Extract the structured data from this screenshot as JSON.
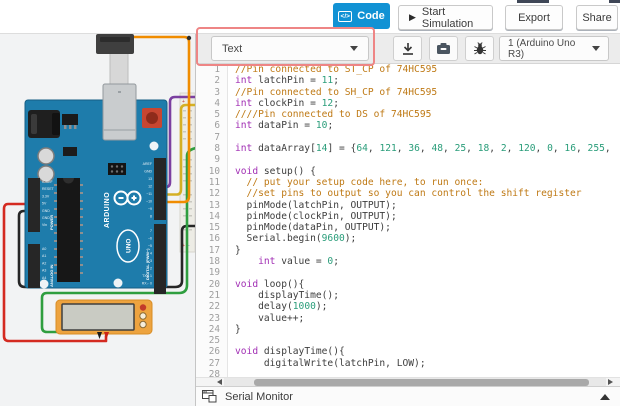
{
  "top_bar": {
    "code_label": "Code",
    "code_icon": "</>",
    "start_simulation_label": "Start Simulation",
    "export_label": "Export",
    "share_label": "Share"
  },
  "code_panel": {
    "toolbar": {
      "edit_mode_value": "Text",
      "board_selector_value": "1 (Arduino Uno R3)",
      "icons": [
        "download-icon",
        "library-icon",
        "debug-icon"
      ]
    },
    "editor": {
      "start_line": 1,
      "lines": [
        [
          {
            "t": "c",
            "s": "//Pin connected to ST_CP of 74HC595"
          }
        ],
        [
          {
            "t": "k",
            "s": "int"
          },
          {
            "t": "p",
            "s": " latchPin = "
          },
          {
            "t": "n",
            "s": "11"
          },
          {
            "t": "p",
            "s": ";"
          }
        ],
        [
          {
            "t": "c",
            "s": "//Pin connected to SH_CP of 74HC595"
          }
        ],
        [
          {
            "t": "k",
            "s": "int"
          },
          {
            "t": "p",
            "s": " clockPin = "
          },
          {
            "t": "n",
            "s": "12"
          },
          {
            "t": "p",
            "s": ";"
          }
        ],
        [
          {
            "t": "c",
            "s": "////Pin connected to DS of 74HC595"
          }
        ],
        [
          {
            "t": "k",
            "s": "int"
          },
          {
            "t": "p",
            "s": " dataPin = "
          },
          {
            "t": "n",
            "s": "10"
          },
          {
            "t": "p",
            "s": ";"
          }
        ],
        [],
        [
          {
            "t": "k",
            "s": "int"
          },
          {
            "t": "p",
            "s": " dataArray["
          },
          {
            "t": "n",
            "s": "14"
          },
          {
            "t": "p",
            "s": "] = {"
          },
          {
            "t": "n",
            "s": "64"
          },
          {
            "t": "p",
            "s": ", "
          },
          {
            "t": "n",
            "s": "121"
          },
          {
            "t": "p",
            "s": ", "
          },
          {
            "t": "n",
            "s": "36"
          },
          {
            "t": "p",
            "s": ", "
          },
          {
            "t": "n",
            "s": "48"
          },
          {
            "t": "p",
            "s": ", "
          },
          {
            "t": "n",
            "s": "25"
          },
          {
            "t": "p",
            "s": ", "
          },
          {
            "t": "n",
            "s": "18"
          },
          {
            "t": "p",
            "s": ", "
          },
          {
            "t": "n",
            "s": "2"
          },
          {
            "t": "p",
            "s": ", "
          },
          {
            "t": "n",
            "s": "120"
          },
          {
            "t": "p",
            "s": ", "
          },
          {
            "t": "n",
            "s": "0"
          },
          {
            "t": "p",
            "s": ", "
          },
          {
            "t": "n",
            "s": "16"
          },
          {
            "t": "p",
            "s": ", "
          },
          {
            "t": "n",
            "s": "255"
          },
          {
            "t": "p",
            "s": ","
          }
        ],
        [],
        [
          {
            "t": "k",
            "s": "void"
          },
          {
            "t": "p",
            "s": " setup() {"
          }
        ],
        [
          {
            "t": "c",
            "s": "  // put your setup code here, to run once:"
          }
        ],
        [
          {
            "t": "c",
            "s": "  //set pins to output so you can control the shift register"
          }
        ],
        [
          {
            "t": "p",
            "s": "  pinMode(latchPin, OUTPUT);"
          }
        ],
        [
          {
            "t": "p",
            "s": "  pinMode(clockPin, OUTPUT);"
          }
        ],
        [
          {
            "t": "p",
            "s": "  pinMode(dataPin, OUTPUT);"
          }
        ],
        [
          {
            "t": "p",
            "s": "  Serial.begin("
          },
          {
            "t": "n",
            "s": "9600"
          },
          {
            "t": "p",
            "s": ");"
          }
        ],
        [
          {
            "t": "p",
            "s": "}"
          }
        ],
        [
          {
            "t": "p",
            "s": "    "
          },
          {
            "t": "k",
            "s": "int"
          },
          {
            "t": "p",
            "s": " value = "
          },
          {
            "t": "n",
            "s": "0"
          },
          {
            "t": "p",
            "s": ";"
          }
        ],
        [],
        [
          {
            "t": "k",
            "s": "void"
          },
          {
            "t": "p",
            "s": " loop(){"
          }
        ],
        [
          {
            "t": "p",
            "s": "    displayTime();"
          }
        ],
        [
          {
            "t": "p",
            "s": "    delay("
          },
          {
            "t": "n",
            "s": "1000"
          },
          {
            "t": "p",
            "s": ");"
          }
        ],
        [
          {
            "t": "p",
            "s": "    value++;"
          }
        ],
        [
          {
            "t": "p",
            "s": "}"
          }
        ],
        [],
        [
          {
            "t": "k",
            "s": "void"
          },
          {
            "t": "p",
            "s": " displayTime(){"
          }
        ],
        [
          {
            "t": "p",
            "s": "     digitalWrite(latchPin, LOW);"
          }
        ],
        []
      ]
    },
    "serial_monitor_label": "Serial Monitor"
  },
  "circuit": {
    "board": {
      "brand": "ARDUINO",
      "model": "UNO",
      "digital_label": "DIGITAL (PWM~)",
      "power_label": "POWER",
      "analog_label": "ANALOG IN",
      "right_pins_top": [
        "AREF",
        "GND",
        "13",
        "12",
        "~11",
        "~10",
        "~9",
        "8"
      ],
      "right_pins_bottom": [
        "7",
        "~6",
        "~5",
        "4",
        "~3",
        "2",
        "TX→1",
        "RX←0"
      ],
      "power_pins": [
        "IOREF",
        "RESET",
        "3.3V",
        "5V",
        "GND",
        "GND",
        "Vin"
      ],
      "analog_pins": [
        "A0",
        "A1",
        "A2",
        "A3",
        "A4",
        "A5"
      ]
    }
  },
  "colors": {
    "code_button_blue": "#1192d4",
    "highlight_red": "#ee8585",
    "comment": "#bf7a16",
    "keyword": "#a12fb4",
    "number": "#2a9d7a",
    "board_blue": "#1e7cab",
    "wire_red": "#d42a20",
    "wire_black": "#262626",
    "wire_green": "#2f9e3f",
    "wire_orange": "#f08c00",
    "wire_yellow": "#d4b024",
    "wire_purple": "#7b3fa0",
    "multimeter_yellow": "#eda33f"
  }
}
